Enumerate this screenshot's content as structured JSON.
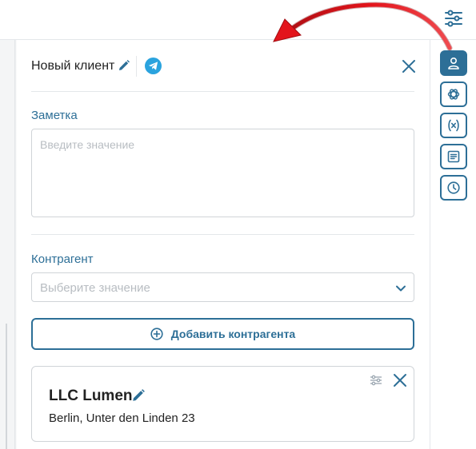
{
  "panel": {
    "title": "Новый клиент",
    "note": {
      "label": "Заметка",
      "placeholder": "Введите значение",
      "value": ""
    },
    "counterparty": {
      "label": "Контрагент",
      "placeholder": "Выберите значение"
    },
    "add_button_label": "Добавить контрагента",
    "card": {
      "name": "LLC Lumen",
      "address": "Berlin, Unter den Linden 23"
    }
  },
  "rail": {
    "items": [
      {
        "icon": "user-icon",
        "active": true
      },
      {
        "icon": "openai-icon",
        "active": false
      },
      {
        "icon": "variable-icon",
        "active": false
      },
      {
        "icon": "document-icon",
        "active": false
      },
      {
        "icon": "clock-icon",
        "active": false
      }
    ]
  },
  "colors": {
    "accent": "#2d6f97",
    "telegram": "#2aa3de",
    "annotation_arrow": "#e3141b"
  }
}
